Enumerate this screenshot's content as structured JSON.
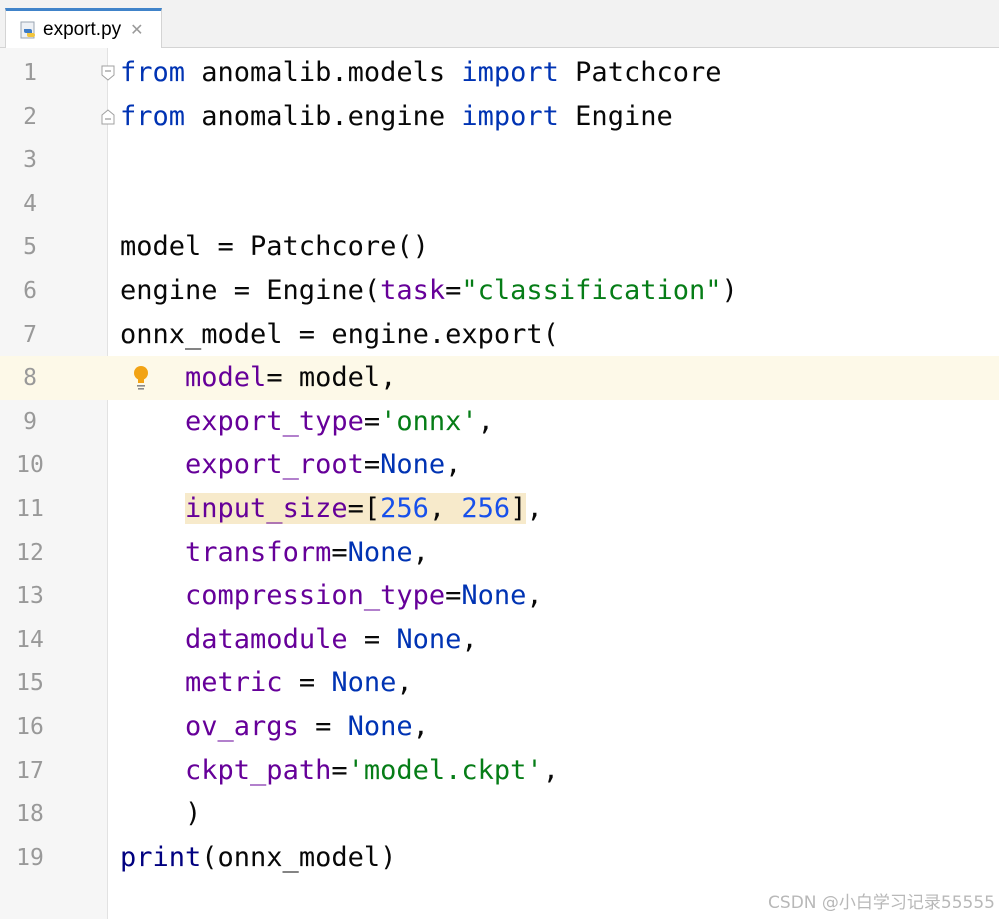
{
  "tab": {
    "filename": "export.py",
    "icon": "python-file-icon",
    "close_glyph": "✕"
  },
  "editor": {
    "lines": [
      {
        "n": "1",
        "tokens": [
          {
            "t": "from",
            "c": "kw"
          },
          {
            "t": " anomalib.models "
          },
          {
            "t": "import",
            "c": "kw"
          },
          {
            "t": " Patchcore"
          }
        ]
      },
      {
        "n": "2",
        "tokens": [
          {
            "t": "from",
            "c": "kw"
          },
          {
            "t": " anomalib.engine "
          },
          {
            "t": "import",
            "c": "kw"
          },
          {
            "t": " Engine"
          }
        ]
      },
      {
        "n": "3",
        "tokens": []
      },
      {
        "n": "4",
        "tokens": []
      },
      {
        "n": "5",
        "tokens": [
          {
            "t": "model = Patchcore()"
          }
        ]
      },
      {
        "n": "6",
        "tokens": [
          {
            "t": "engine = Engine("
          },
          {
            "t": "task",
            "c": "param"
          },
          {
            "t": "="
          },
          {
            "t": "\"classification\"",
            "c": "str"
          },
          {
            "t": ")"
          }
        ]
      },
      {
        "n": "7",
        "tokens": [
          {
            "t": "onnx_model = engine.export("
          }
        ]
      },
      {
        "n": "8",
        "tokens": [
          {
            "t": "    "
          },
          {
            "t": "model",
            "c": "param"
          },
          {
            "t": "= model,"
          }
        ]
      },
      {
        "n": "9",
        "tokens": [
          {
            "t": "    "
          },
          {
            "t": "export_type",
            "c": "param"
          },
          {
            "t": "="
          },
          {
            "t": "'onnx'",
            "c": "str"
          },
          {
            "t": ","
          }
        ]
      },
      {
        "n": "10",
        "tokens": [
          {
            "t": "    "
          },
          {
            "t": "export_root",
            "c": "param"
          },
          {
            "t": "="
          },
          {
            "t": "None",
            "c": "kw"
          },
          {
            "t": ","
          }
        ]
      },
      {
        "n": "11",
        "tokens": [
          {
            "t": "    "
          },
          {
            "t": "input_size",
            "c": "param hl"
          },
          {
            "t": "=[",
            "c": "hl"
          },
          {
            "t": "256",
            "c": "num hl"
          },
          {
            "t": ", ",
            "c": "hl"
          },
          {
            "t": "256",
            "c": "num hl"
          },
          {
            "t": "]",
            "c": "hl"
          },
          {
            "t": ","
          }
        ]
      },
      {
        "n": "12",
        "tokens": [
          {
            "t": "    "
          },
          {
            "t": "transform",
            "c": "param"
          },
          {
            "t": "="
          },
          {
            "t": "None",
            "c": "kw"
          },
          {
            "t": ","
          }
        ]
      },
      {
        "n": "13",
        "tokens": [
          {
            "t": "    "
          },
          {
            "t": "compression_type",
            "c": "param"
          },
          {
            "t": "="
          },
          {
            "t": "None",
            "c": "kw"
          },
          {
            "t": ","
          }
        ]
      },
      {
        "n": "14",
        "tokens": [
          {
            "t": "    "
          },
          {
            "t": "datamodule",
            "c": "param"
          },
          {
            "t": " = "
          },
          {
            "t": "None",
            "c": "kw"
          },
          {
            "t": ","
          }
        ]
      },
      {
        "n": "15",
        "tokens": [
          {
            "t": "    "
          },
          {
            "t": "metric",
            "c": "param"
          },
          {
            "t": " = "
          },
          {
            "t": "None",
            "c": "kw"
          },
          {
            "t": ","
          }
        ]
      },
      {
        "n": "16",
        "tokens": [
          {
            "t": "    "
          },
          {
            "t": "ov_args",
            "c": "param"
          },
          {
            "t": " = "
          },
          {
            "t": "None",
            "c": "kw"
          },
          {
            "t": ","
          }
        ]
      },
      {
        "n": "17",
        "tokens": [
          {
            "t": "    "
          },
          {
            "t": "ckpt_path",
            "c": "param"
          },
          {
            "t": "="
          },
          {
            "t": "'model.ckpt'",
            "c": "str"
          },
          {
            "t": ","
          }
        ]
      },
      {
        "n": "18",
        "tokens": [
          {
            "t": "    )"
          }
        ]
      },
      {
        "n": "19",
        "tokens": [
          {
            "t": "print",
            "c": "fn"
          },
          {
            "t": "(onnx_model)"
          }
        ]
      }
    ],
    "current_line": "8",
    "fold_lines": [
      "1",
      "2"
    ],
    "intention_bulb_line": "8"
  },
  "watermark": "CSDN @小白学习记录55555",
  "colors": {
    "keyword": "#0033b3",
    "param": "#660099",
    "string": "#067d17",
    "number": "#1750eb",
    "builtin": "#000080",
    "current_line": "#fdf9e8",
    "highlight": "#f7eacb",
    "tab_accent": "#4083c9"
  }
}
